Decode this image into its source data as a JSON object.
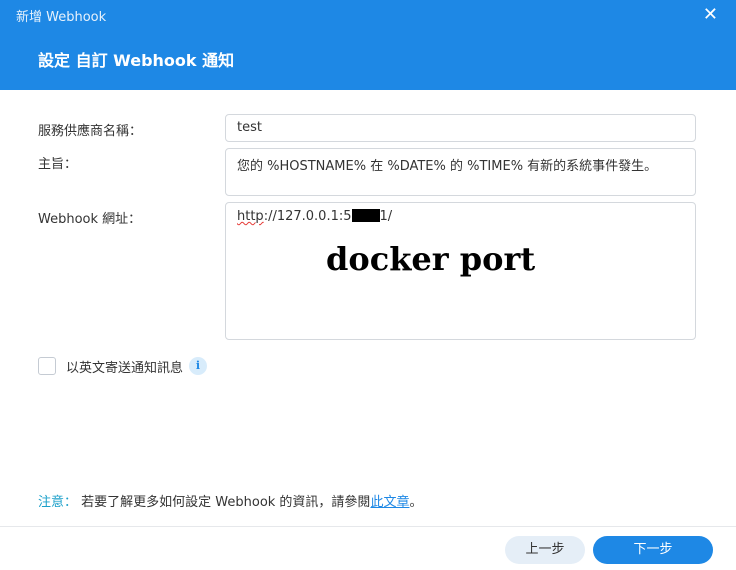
{
  "window": {
    "title": "新增 Webhook"
  },
  "dialog": {
    "title": "設定 自訂 Webhook 通知"
  },
  "form": {
    "provider_label": "服務供應商名稱：",
    "provider_value": "test",
    "subject_label": "主旨：",
    "subject_value": "您的 %HOSTNAME% 在 %DATE% 的 %TIME% 有新的系統事件發生。",
    "url_label": "Webhook 網址：",
    "url_scheme": "http",
    "url_prefix": "://127.0.0.1:5",
    "url_suffix": "1/",
    "url_annotation": "docker port",
    "checkbox_label": "以英文寄送通知訊息",
    "checkbox_checked": false
  },
  "note": {
    "label": "注意：",
    "text": " 若要了解更多如何設定 Webhook 的資訊，請參閱",
    "link": "此文章",
    "end": "。"
  },
  "buttons": {
    "prev": "上一步",
    "next": "下一步"
  },
  "colors": {
    "accent": "#1e88e5",
    "note": "#1a9fc9"
  },
  "icons": {
    "close": "close-icon",
    "info": "info-icon",
    "checkbox": "checkbox-icon"
  }
}
